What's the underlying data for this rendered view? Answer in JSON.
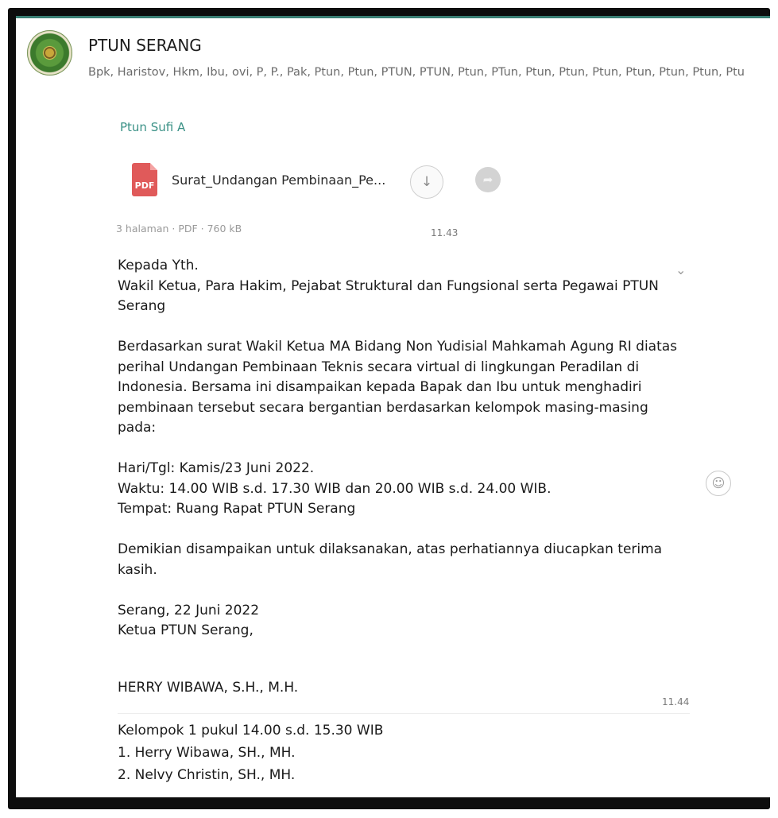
{
  "chat": {
    "title": "PTUN SERANG",
    "members": "Bpk, Haristov, Hkm, Ibu, ovi, P, P., Pak, Ptun, Ptun, PTUN, PTUN, Ptun, PTun, Ptun, Ptun, Ptun, Ptun, Ptun, Ptun, Ptu"
  },
  "message1": {
    "sender": "Ptun Sufi A",
    "document": {
      "icon_label": "PDF",
      "filename": "Surat_Undangan Pembinaan_Pe...",
      "meta": "3 halaman · PDF · 760 kB",
      "time": "11.43"
    }
  },
  "message2": {
    "lines": [
      "Kepada Yth.",
      "Wakil Ketua, Para Hakim, Pejabat Struktural dan Fungsional serta Pegawai PTUN Serang",
      "",
      "Berdasarkan surat Wakil Ketua MA Bidang Non Yudisial Mahkamah Agung RI diatas perihal Undangan Pembinaan Teknis secara virtual di lingkungan Peradilan di Indonesia. Bersama ini disampaikan kepada Bapak dan Ibu untuk menghadiri pembinaan tersebut secara bergantian berdasarkan kelompok masing-masing pada:",
      "",
      "Hari/Tgl: Kamis/23 Juni 2022.",
      "Waktu: 14.00 WIB s.d. 17.30 WIB dan 20.00 WIB s.d. 24.00 WIB.",
      "Tempat: Ruang Rapat PTUN Serang",
      "",
      "Demikian disampaikan untuk dilaksanakan, atas perhatiannya diucapkan terima kasih.",
      "",
      "Serang, 22 Juni 2022",
      "Ketua PTUN Serang,"
    ],
    "signature": "HERRY WIBAWA, S.H., M.H.",
    "time": "11.44"
  },
  "message3": {
    "lines": [
      "Kelompok 1 pukul 14.00 s.d. 15.30 WIB",
      "1. Herry Wibawa, SH., MH.",
      "2. Nelvy Christin, SH., MH."
    ]
  },
  "icons": {
    "download": "download-arrow-icon",
    "forward": "forward-share-icon",
    "chevron": "chevron-down-icon",
    "emoji": "emoji-react-icon"
  },
  "colors": {
    "sender_name": "#3a9186",
    "pdf_icon": "#e05a5a",
    "header_line": "#3b7f74"
  }
}
